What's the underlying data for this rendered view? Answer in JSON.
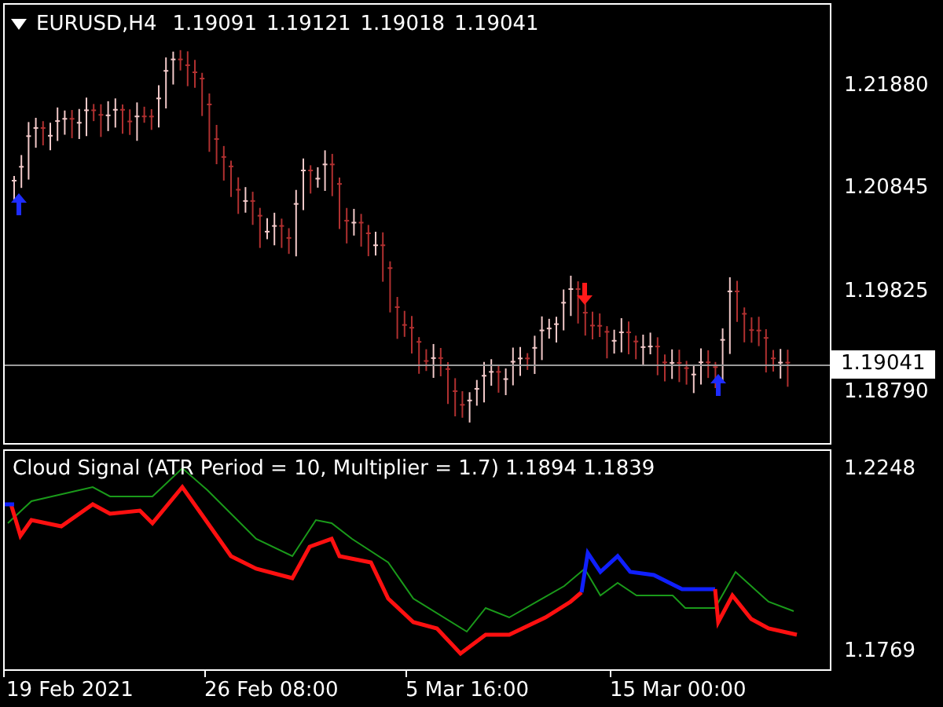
{
  "main_chart": {
    "symbol": "EURUSD,H4",
    "open": "1.19091",
    "high": "1.19121",
    "low": "1.19018",
    "close": "1.19041",
    "price_ticks": [
      "1.21880",
      "1.20845",
      "1.19825",
      "1.18790"
    ],
    "current_price": "1.19041"
  },
  "indicator": {
    "title": "Cloud Signal (ATR Period = 10, Multiplier = 1.7) 1.1894 1.1839",
    "ticks": [
      "1.2248",
      "1.1769"
    ]
  },
  "time_axis": [
    "19 Feb 2021",
    "26 Feb 08:00",
    "5 Mar 16:00",
    "15 Mar 00:00"
  ]
}
